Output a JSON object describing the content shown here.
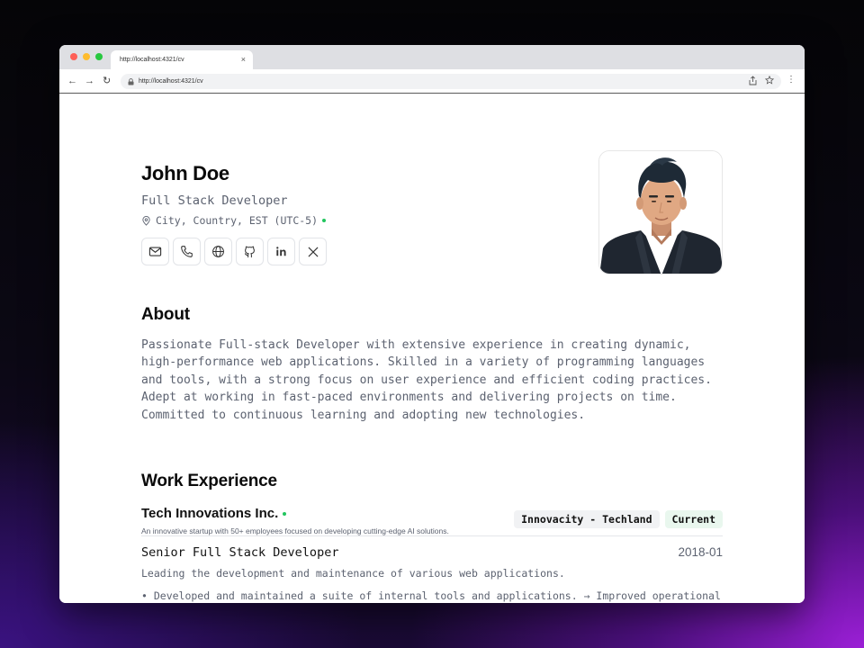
{
  "browser": {
    "tab_title": "http://localhost:4321/cv",
    "tab_close": "×",
    "address": "http://localhost:4321/cv",
    "back": "←",
    "forward": "→",
    "reload": "↻",
    "menu": "⋮"
  },
  "header": {
    "name": "John Doe",
    "title": "Full Stack Developer",
    "location": "City, Country, EST (UTC-5)"
  },
  "socials": [
    "email-icon",
    "phone-icon",
    "globe-icon",
    "github-icon",
    "linkedin-icon",
    "x-icon"
  ],
  "about": {
    "heading": "About",
    "text": "Passionate Full-stack Developer with extensive experience in creating dynamic, high-performance web applications. Skilled in a variety of programming languages and tools, with a strong focus on user experience and efficient coding practices. Adept at working in fast-paced environments and delivering projects on time. Committed to continuous learning and adopting new technologies."
  },
  "work": {
    "heading": "Work Experience",
    "company": "Tech Innovations Inc.",
    "company_desc": "An innovative startup with 50+ employees focused on developing cutting-edge AI solutions.",
    "location_badge": "Innovacity - Techland",
    "status_badge": "Current",
    "role": "Senior Full Stack Developer",
    "date": "2018-01",
    "role_desc": "Leading the development and maintenance of various web applications.",
    "bullet": "• Developed and maintained a suite of internal tools and applications. → Improved operational"
  }
}
